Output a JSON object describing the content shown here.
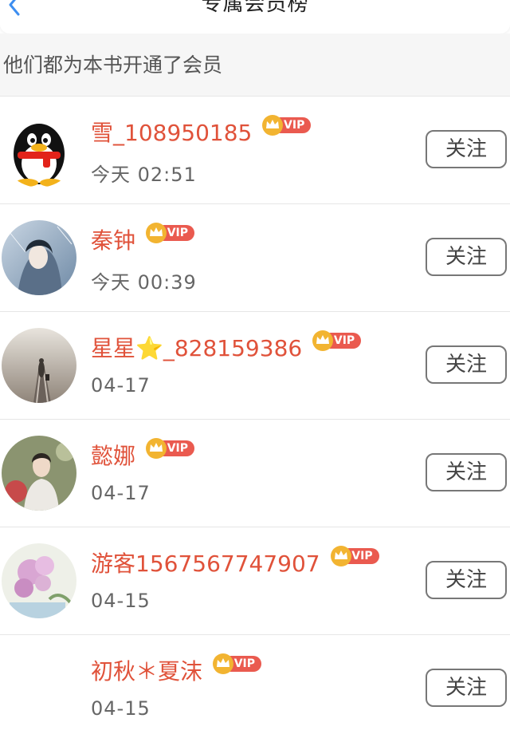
{
  "header": {
    "title": "专属会员榜"
  },
  "subheader": {
    "text": "他们都为本书开通了会员"
  },
  "vip_label": "VIP",
  "colors": {
    "name": "#e0523a",
    "vip": "#ea5a4f",
    "crown": "#f2b431",
    "back_arrow": "#3d8ef0"
  },
  "members": [
    {
      "name": "雪_108950185",
      "time": "今天 02:51",
      "follow_label": "关注",
      "avatar_icon": "qq-penguin-icon"
    },
    {
      "name": "秦钟",
      "time": "今天 00:39",
      "follow_label": "关注",
      "avatar_icon": "avatar-photo"
    },
    {
      "name": "星星⭐_828159386",
      "time": "04-17",
      "follow_label": "关注",
      "avatar_icon": "avatar-photo"
    },
    {
      "name": "懿娜",
      "time": "04-17",
      "follow_label": "关注",
      "avatar_icon": "avatar-photo"
    },
    {
      "name": "游客1567567747907",
      "time": "04-15",
      "follow_label": "关注",
      "avatar_icon": "avatar-photo"
    },
    {
      "name": "初秋＊夏沫",
      "time": "04-15",
      "follow_label": "关注",
      "avatar_icon": "avatar-photo"
    }
  ]
}
